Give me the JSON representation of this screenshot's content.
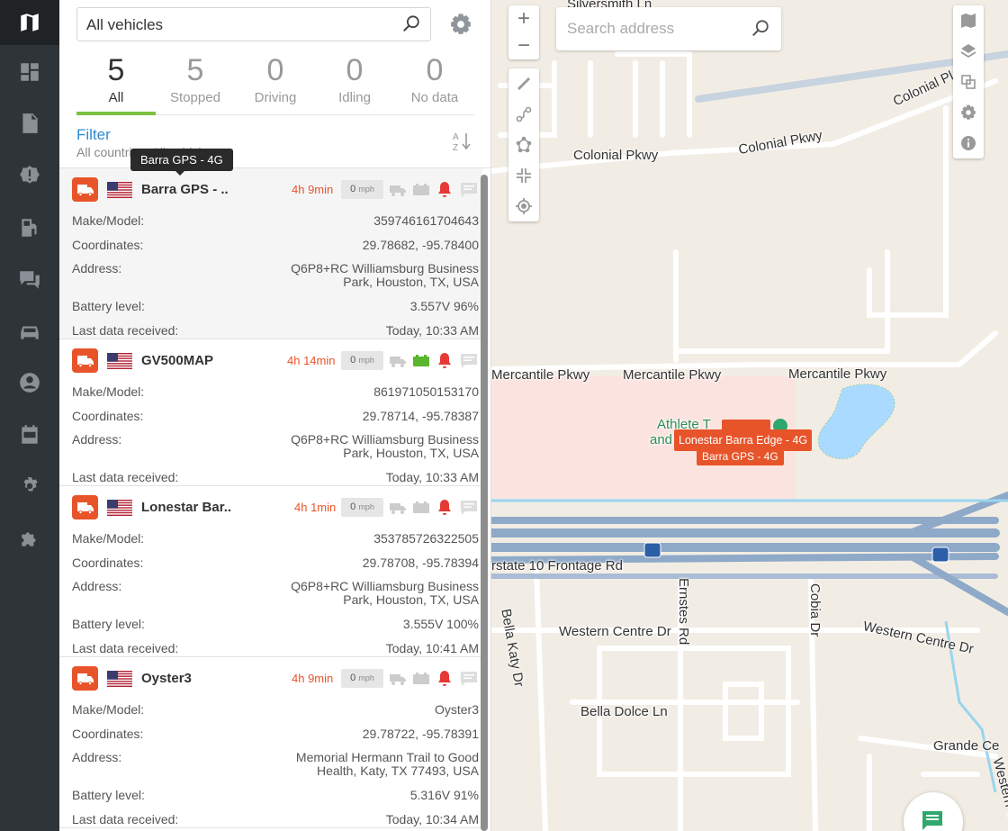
{
  "nav": {
    "items": [
      {
        "name": "nav-map",
        "icon": "map-icon",
        "active": true
      },
      {
        "name": "nav-dashboard",
        "icon": "dashboard-icon"
      },
      {
        "name": "nav-reports",
        "icon": "document-icon"
      },
      {
        "name": "nav-alerts",
        "icon": "alert-icon"
      },
      {
        "name": "nav-fuel",
        "icon": "fuel-icon"
      },
      {
        "name": "nav-messages",
        "icon": "chat-icon"
      },
      {
        "name": "nav-vehicles",
        "icon": "car-icon"
      },
      {
        "name": "nav-drivers",
        "icon": "user-icon"
      },
      {
        "name": "nav-tasks",
        "icon": "calendar-icon"
      },
      {
        "name": "nav-settings",
        "icon": "gear-icon"
      },
      {
        "name": "nav-plugins",
        "icon": "puzzle-icon"
      }
    ]
  },
  "vehicle_select": {
    "value": "All vehicles"
  },
  "stats": [
    {
      "count": "5",
      "label": "All",
      "active": true
    },
    {
      "count": "5",
      "label": "Stopped"
    },
    {
      "count": "0",
      "label": "Driving"
    },
    {
      "count": "0",
      "label": "Idling"
    },
    {
      "count": "0",
      "label": "No data"
    }
  ],
  "filter": {
    "title": "Filter",
    "summary": "All countries, All vehicles"
  },
  "tooltip": "Barra GPS - 4G",
  "vehicles": [
    {
      "name": "Barra GPS - ..",
      "time": "4h 9min",
      "speed": "0",
      "speed_unit": "mph",
      "battery_ok": false,
      "make_model": "359746161704643",
      "coordinates": "29.78682, -95.78400",
      "address": "Q6P8+RC Williamsburg Business Park, Houston, TX, USA",
      "battery": "3.557V 96%",
      "last_data": "Today, 10:33 AM",
      "selected": true
    },
    {
      "name": "GV500MAP",
      "time": "4h 14min",
      "speed": "0",
      "speed_unit": "mph",
      "battery_ok": true,
      "make_model": "861971050153170",
      "coordinates": "29.78714, -95.78387",
      "address": "Q6P8+RC Williamsburg Business Park, Houston, TX, USA",
      "battery": null,
      "last_data": "Today, 10:33 AM"
    },
    {
      "name": "Lonestar Bar..",
      "time": "4h 1min",
      "speed": "0",
      "speed_unit": "mph",
      "battery_ok": false,
      "make_model": "353785726322505",
      "coordinates": "29.78708, -95.78394",
      "address": "Q6P8+RC Williamsburg Business Park, Houston, TX, USA",
      "battery": "3.555V 100%",
      "last_data": "Today, 10:41 AM"
    },
    {
      "name": "Oyster3",
      "time": "4h 9min",
      "speed": "0",
      "speed_unit": "mph",
      "battery_ok": false,
      "make_model": "Oyster3",
      "coordinates": "29.78722, -95.78391",
      "address": "Memorial Hermann Trail to Good Health, Katy, TX 77493, USA",
      "battery": "5.316V 91%",
      "last_data": "Today, 10:34 AM"
    }
  ],
  "labels": {
    "make_model": "Make/Model:",
    "coordinates": "Coordinates:",
    "address": "Address:",
    "battery": "Battery level:",
    "last_data": "Last data received:"
  },
  "map": {
    "search_placeholder": "Search address",
    "road_labels": {
      "colonial1": "Colonial Pkwy",
      "colonial2": "Colonial Pkwy",
      "colonial3": "Colonial Pl",
      "merc1": "Mercantile Pkwy",
      "merc2": "Mercantile Pkwy",
      "merc3": "Mercantile Pkwy",
      "frontage": "rstate 10 Frontage Rd",
      "bellakaty": "Bella Katy Dr",
      "ernstes": "Ernstes Rd",
      "cobia": "Cobia Dr",
      "western1": "Western Centre Dr",
      "western2": "Western Centre Dr",
      "western3": "Western Centr",
      "belladolce": "Bella Dolce Ln",
      "grande": "Grande Ce",
      "silversmith": "Silversmith Ln",
      "athlete": "Athlete T",
      "and": "and"
    },
    "markers": {
      "lonestar": "Lonestar Barra Edge - 4G",
      "barra": "Barra GPS - 4G"
    },
    "colors": {
      "accent": "#e8542a",
      "active_tab": "#7dc243",
      "link": "#2e8bd1"
    }
  }
}
